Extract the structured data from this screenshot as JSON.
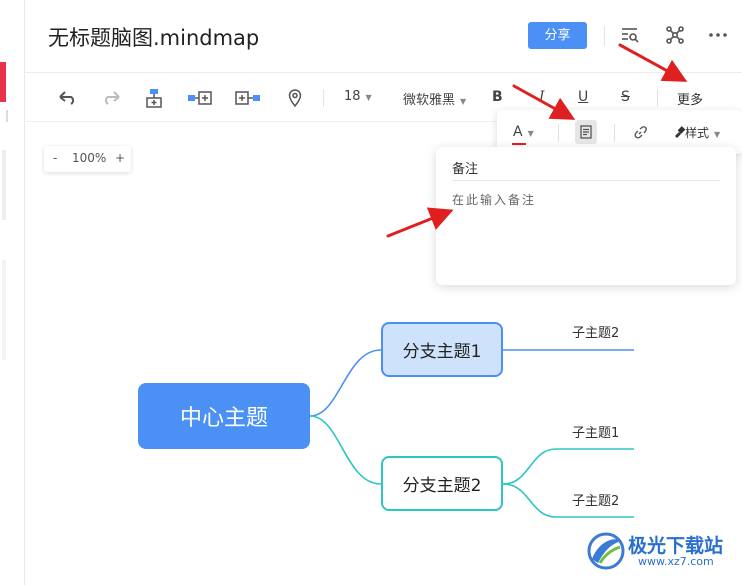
{
  "header": {
    "title": "无标题脑图.mindmap",
    "share_label": "分享"
  },
  "toolbar": {
    "font_size": "18",
    "font_family": "微软雅黑",
    "bold": "B",
    "italic": "I",
    "underline": "U",
    "strike": "S",
    "more_label": "更多"
  },
  "more_panel": {
    "font_color_label": "A",
    "style_label": "样式"
  },
  "zoom": {
    "minus": "-",
    "level": "100%",
    "plus": "+"
  },
  "notes": {
    "title": "备注",
    "placeholder": "在此输入备注"
  },
  "mindmap": {
    "center": "中心主题",
    "branch1": {
      "label": "分支主题1",
      "children": [
        "子主题2"
      ]
    },
    "branch2": {
      "label": "分支主题2",
      "children": [
        "子主题1",
        "子主题2"
      ]
    }
  },
  "watermark": {
    "name": "极光下载站",
    "url": "www.xz7.com"
  },
  "colors": {
    "accent": "#4a90f5",
    "teal": "#2ec5c2",
    "arrow": "#e02020"
  }
}
